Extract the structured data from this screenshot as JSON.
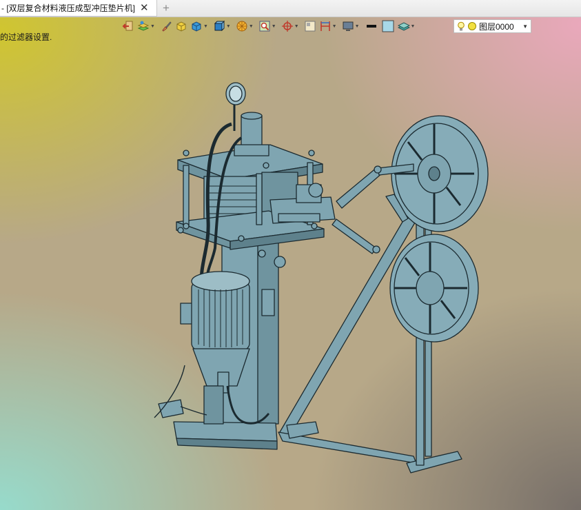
{
  "tab": {
    "title": "- [双层复合材料液压成型冲压垫片机]",
    "close_glyph": "✕",
    "new_tab_glyph": "+"
  },
  "status": {
    "message": "的过滤器设置."
  },
  "toolbar": {
    "items": [
      {
        "icon": "exit-icon",
        "dropdown": false
      },
      {
        "icon": "layers-manager-icon",
        "dropdown": true
      },
      {
        "icon": "paint-brush-icon",
        "dropdown": false
      },
      {
        "icon": "yellow-cube-icon",
        "dropdown": false
      },
      {
        "icon": "blue-box-icon",
        "dropdown": true
      },
      {
        "icon": "view-cube-icon",
        "dropdown": true
      },
      {
        "icon": "render-sphere-icon",
        "dropdown": true
      },
      {
        "icon": "zoom-window-icon",
        "dropdown": true
      },
      {
        "icon": "crosshair-icon",
        "dropdown": true
      },
      {
        "icon": "section-box-icon",
        "dropdown": false
      },
      {
        "icon": "dimension-icon",
        "dropdown": true
      },
      {
        "icon": "monitor-icon",
        "dropdown": true
      },
      {
        "icon": "line-weight-icon",
        "dropdown": false
      },
      {
        "icon": "color-swatch-icon",
        "dropdown": false
      },
      {
        "icon": "layer-stack-icon",
        "dropdown": true
      }
    ],
    "accent_color": "#a8d8e8"
  },
  "layer_selector": {
    "value": "图层0000",
    "icons": [
      "lightbulb-icon",
      "sun-icon"
    ]
  },
  "model": {
    "name": "双层复合材料液压成型冲压垫片机",
    "fill_color": "#7fa5b1",
    "edge_color": "#1b2a30"
  }
}
